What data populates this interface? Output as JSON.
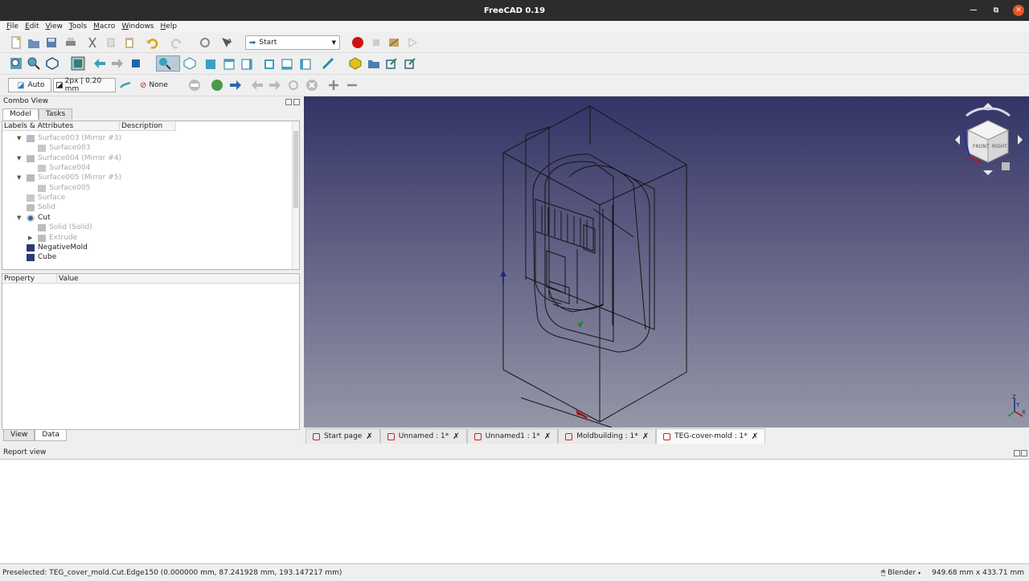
{
  "window": {
    "title": "FreeCAD 0.19"
  },
  "menu": [
    "File",
    "Edit",
    "View",
    "Tools",
    "Macro",
    "Windows",
    "Help"
  ],
  "toolbar": {
    "workbench": "Start",
    "auto_label": "Auto",
    "linewidth_label": "2px | 0.20 mm",
    "none_label": "None"
  },
  "combo": {
    "title": "Combo View",
    "tabs": [
      "Model",
      "Tasks"
    ],
    "tree_headers": [
      "Labels & Attributes",
      "Description"
    ],
    "tree": [
      {
        "label": "Surface003 (Mirror #3)",
        "dim": true
      },
      {
        "label": "Surface003",
        "dim": true
      },
      {
        "label": "Surface004 (Mirror #4)",
        "dim": true
      },
      {
        "label": "Surface004",
        "dim": true
      },
      {
        "label": "Surface005 (Mirror #5)",
        "dim": true
      },
      {
        "label": "Surface005",
        "dim": true
      },
      {
        "label": "Surface",
        "dim": true
      },
      {
        "label": "Solid",
        "dim": true
      },
      {
        "label": "Cut",
        "dim": false
      },
      {
        "label": "Solid (Solid)",
        "dim": true
      },
      {
        "label": "Extrude",
        "dim": true
      },
      {
        "label": "NegativeMold",
        "dim": false
      },
      {
        "label": "Cube",
        "dim": false
      }
    ],
    "prop_headers": [
      "Property",
      "Value"
    ],
    "bottom_tabs": [
      "View",
      "Data"
    ]
  },
  "doc_tabs": [
    {
      "label": "Start page"
    },
    {
      "label": "Unnamed : 1*"
    },
    {
      "label": "Unnamed1 : 1*"
    },
    {
      "label": "Moldbuilding : 1*"
    },
    {
      "label": "TEG-cover-mold : 1*"
    }
  ],
  "report": {
    "title": "Report view"
  },
  "status": {
    "preselected": "Preselected: TEG_cover_mold.Cut.Edge150 (0.000000 mm, 87.241928 mm, 193.147217 mm)",
    "nav_style": "Blender",
    "dimensions": "949.68 mm x 433.71 mm"
  },
  "axis_labels": {
    "z": "Z",
    "y": "Y",
    "x": "X"
  },
  "colors": {
    "title_bg": "#2c2c2c",
    "close_btn": "#e95420",
    "viewport_top": "#333366",
    "viewport_bottom": "#9696a8",
    "record": "#cc1111"
  }
}
